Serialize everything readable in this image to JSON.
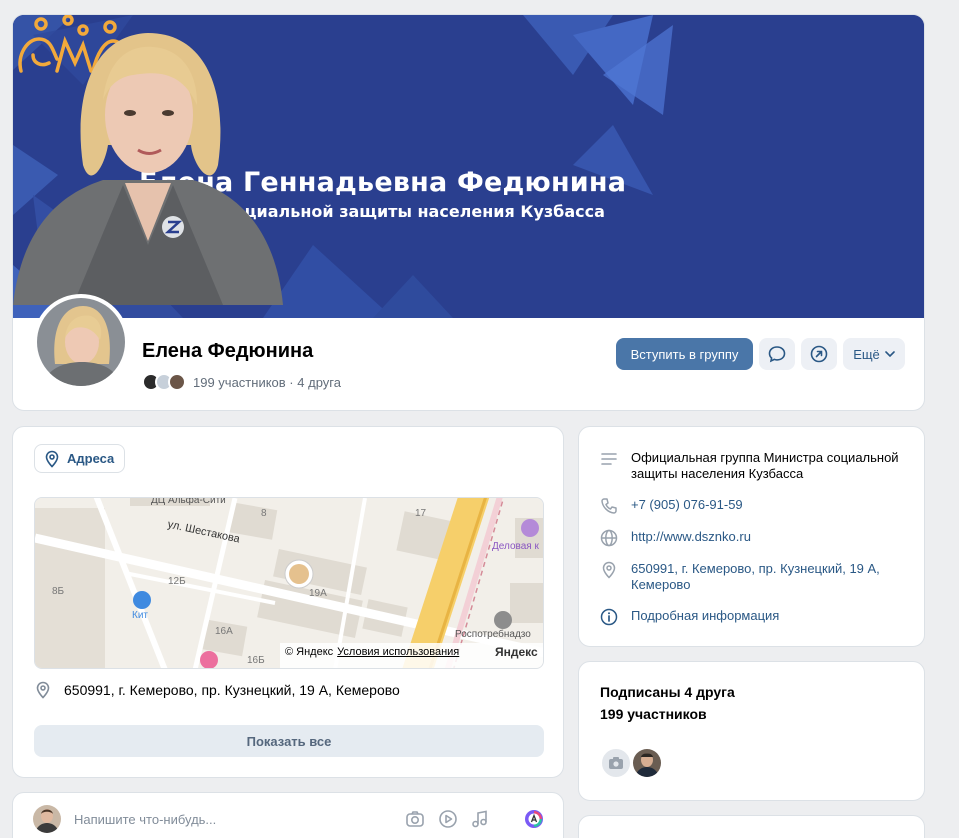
{
  "cover": {
    "title": "Елена Геннадьевна Федюнина",
    "subtitle": "Министр социальной защиты населения Кузбасса",
    "background_color": "#2a3f8f",
    "logo_color": "#f2a93b"
  },
  "group": {
    "name": "Елена Федюнина",
    "members": "199 участников",
    "separator": "·",
    "friends": "4 друга"
  },
  "actions": {
    "join": "Вступить в группу",
    "message_icon": "message-icon",
    "share_icon": "share-icon",
    "more": "Ещё"
  },
  "address": {
    "chip": "Адреса",
    "map_labels": {
      "street": "ул. Шестакова",
      "dc": "ДЦ Альфа-Сити",
      "b8": "8",
      "b17": "17",
      "b12b": "12Б",
      "b8b": "8Б",
      "b19a": "19А",
      "b16a": "16А",
      "b16b": "16Б",
      "kit": "Кит",
      "delovaya": "Деловая к",
      "rospotreb": "Роспотребнадзо",
      "copyright": "© Яндекс",
      "terms": "Условия использования",
      "brand": "Яндекс"
    },
    "full": "650991, г. Кемерово, пр. Кузнецкий, 19 А, Кемерово",
    "show_all": "Показать все"
  },
  "post": {
    "placeholder": "Напишите что-нибудь..."
  },
  "info": {
    "description": "Официальная группа Министра социальной защиты населения Кузбасса",
    "phone": "+7 (905) 076-91-59",
    "site": "http://www.dsznko.ru",
    "address": "650991, г. Кемерово, пр. Кузнецкий, 19 А, Кемерово",
    "details": "Подробная информация"
  },
  "subscribers": {
    "friends_line": "Подписаны 4 друга",
    "members_line": "199 участников"
  },
  "colors": {
    "accent": "#4a76a8",
    "link": "#2a5885",
    "muted": "#626d7a"
  }
}
